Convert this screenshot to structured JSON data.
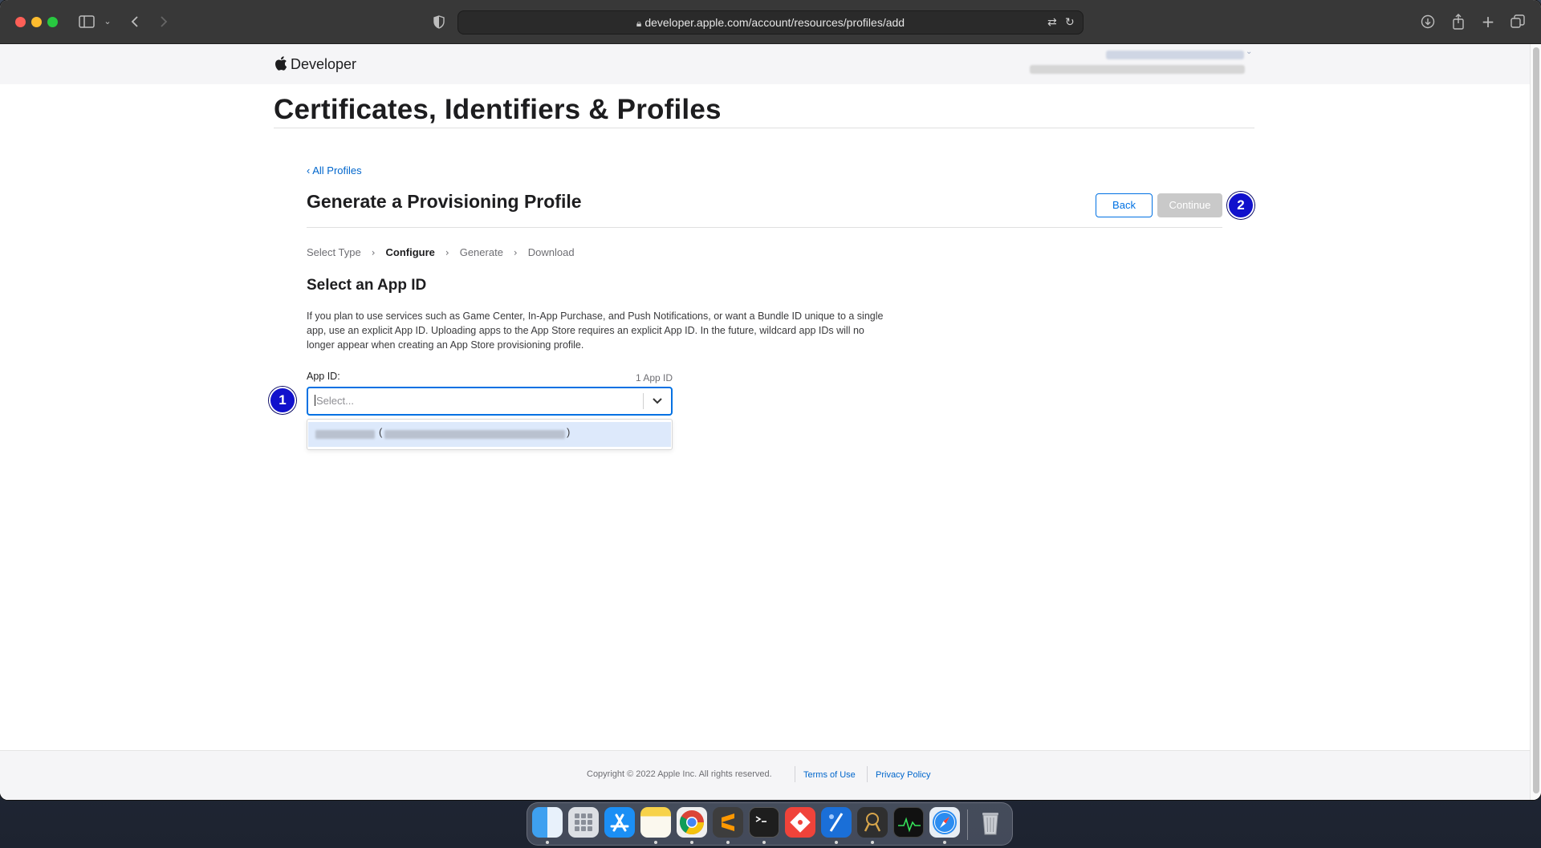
{
  "browser": {
    "url": "developer.apple.com/account/resources/profiles/add"
  },
  "header": {
    "brand": "Developer"
  },
  "page": {
    "title": "Certificates, Identifiers & Profiles",
    "back_link": "‹ All Profiles",
    "section_title": "Generate a Provisioning Profile",
    "back_button": "Back",
    "continue_button": "Continue",
    "steps": [
      "Select Type",
      "Configure",
      "Generate",
      "Download"
    ],
    "active_step": "Configure",
    "subsection_title": "Select an App ID",
    "description": "If you plan to use services such as Game Center, In-App Purchase, and Push Notifications, or want a Bundle ID unique to a single app, use an explicit App ID. Uploading apps to the App Store requires an explicit App ID. In the future, wildcard app IDs will no longer appear when creating an App Store provisioning profile.",
    "field_label": "App ID:",
    "field_count": "1 App ID",
    "select_placeholder": "Select...",
    "dropdown_open_paren": "(",
    "dropdown_close_paren": ")"
  },
  "annotations": {
    "badge_1": "1",
    "badge_2": "2"
  },
  "footer": {
    "copyright": "Copyright © 2022 Apple Inc. All rights reserved.",
    "terms": "Terms of Use",
    "privacy": "Privacy Policy"
  },
  "dock": {
    "apps": [
      "finder-icon",
      "launchpad-icon",
      "app-store-icon",
      "notes-icon",
      "chrome-icon",
      "sublime-text-icon",
      "terminal-icon",
      "git-client-icon",
      "xcode-icon",
      "instruments-icon",
      "activity-monitor-icon",
      "safari-icon",
      "trash-icon"
    ]
  },
  "colors": {
    "accent": "#0071e3",
    "link": "#0066cc",
    "badge": "#1111cc",
    "selected_row": "#dde9fb",
    "disabled_button": "#c9c9c9"
  }
}
